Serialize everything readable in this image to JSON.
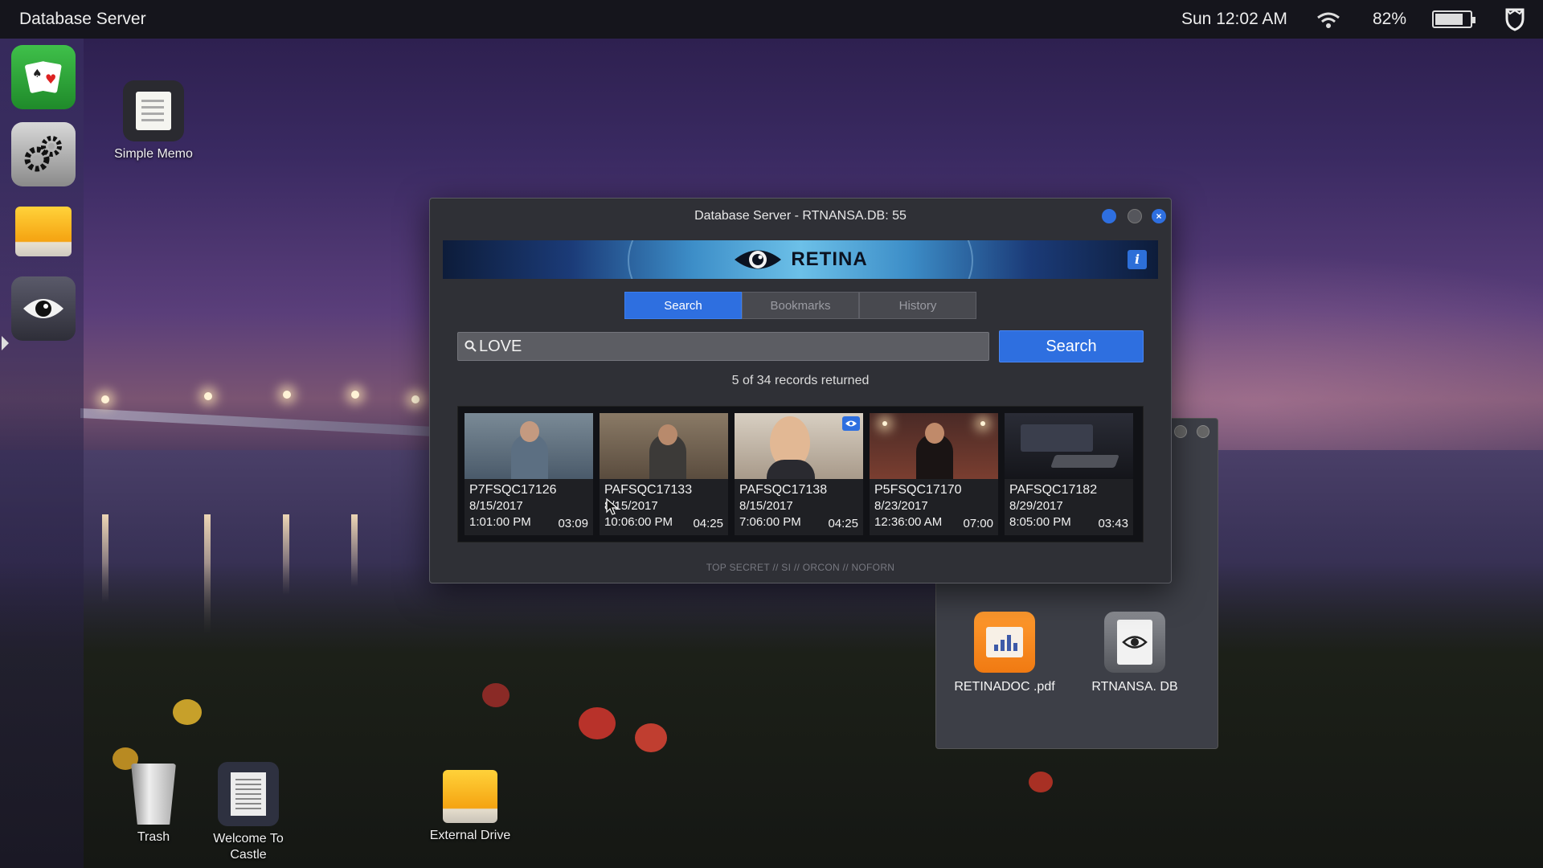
{
  "menubar": {
    "app_name": "Database Server",
    "clock": "Sun 12:02 AM",
    "battery_percent": "82%",
    "battery_level": 0.82
  },
  "dock": {
    "items": [
      {
        "name": "cards-icon"
      },
      {
        "name": "gears-icon"
      },
      {
        "name": "drive-icon"
      },
      {
        "name": "eye-icon"
      }
    ]
  },
  "desktop": {
    "simple_memo": "Simple Memo",
    "trash": "Trash",
    "welcome": "Welcome To Castle",
    "external_drive": "External Drive"
  },
  "files_window": {
    "files": [
      {
        "name": "RETINADOC .pdf",
        "icon": "pdf-chart-icon"
      },
      {
        "name": "RTNANSA. DB",
        "icon": "db-eye-icon"
      }
    ]
  },
  "window": {
    "title": "Database Server - RTNANSA.DB: 55",
    "brand": "RETINA",
    "info_label": "i",
    "tabs": [
      {
        "label": "Search",
        "active": true
      },
      {
        "label": "Bookmarks",
        "active": false
      },
      {
        "label": "History",
        "active": false
      }
    ],
    "search": {
      "value": "LOVE",
      "button_label": "Search"
    },
    "records_text": "5 of 34 records returned",
    "results": [
      {
        "id": "P7FSQC17126",
        "date": "8/15/2017",
        "time": "1:01:00 PM",
        "duration": "03:09",
        "bookmarked": false
      },
      {
        "id": "PAFSQC17133",
        "date": "8/15/2017",
        "time": "10:06:00 PM",
        "duration": "04:25",
        "bookmarked": false
      },
      {
        "id": "PAFSQC17138",
        "date": "8/15/2017",
        "time": "7:06:00 PM",
        "duration": "04:25",
        "bookmarked": true
      },
      {
        "id": "P5FSQC17170",
        "date": "8/23/2017",
        "time": "12:36:00 AM",
        "duration": "07:00",
        "bookmarked": false
      },
      {
        "id": "PAFSQC17182",
        "date": "8/29/2017",
        "time": "8:05:00 PM",
        "duration": "03:43",
        "bookmarked": false
      }
    ],
    "classification": "TOP SECRET // SI // ORCON // NOFORN"
  },
  "colors": {
    "accent": "#2e6fe0",
    "window_bg": "#2f3036",
    "menubar_bg": "#15151c"
  }
}
